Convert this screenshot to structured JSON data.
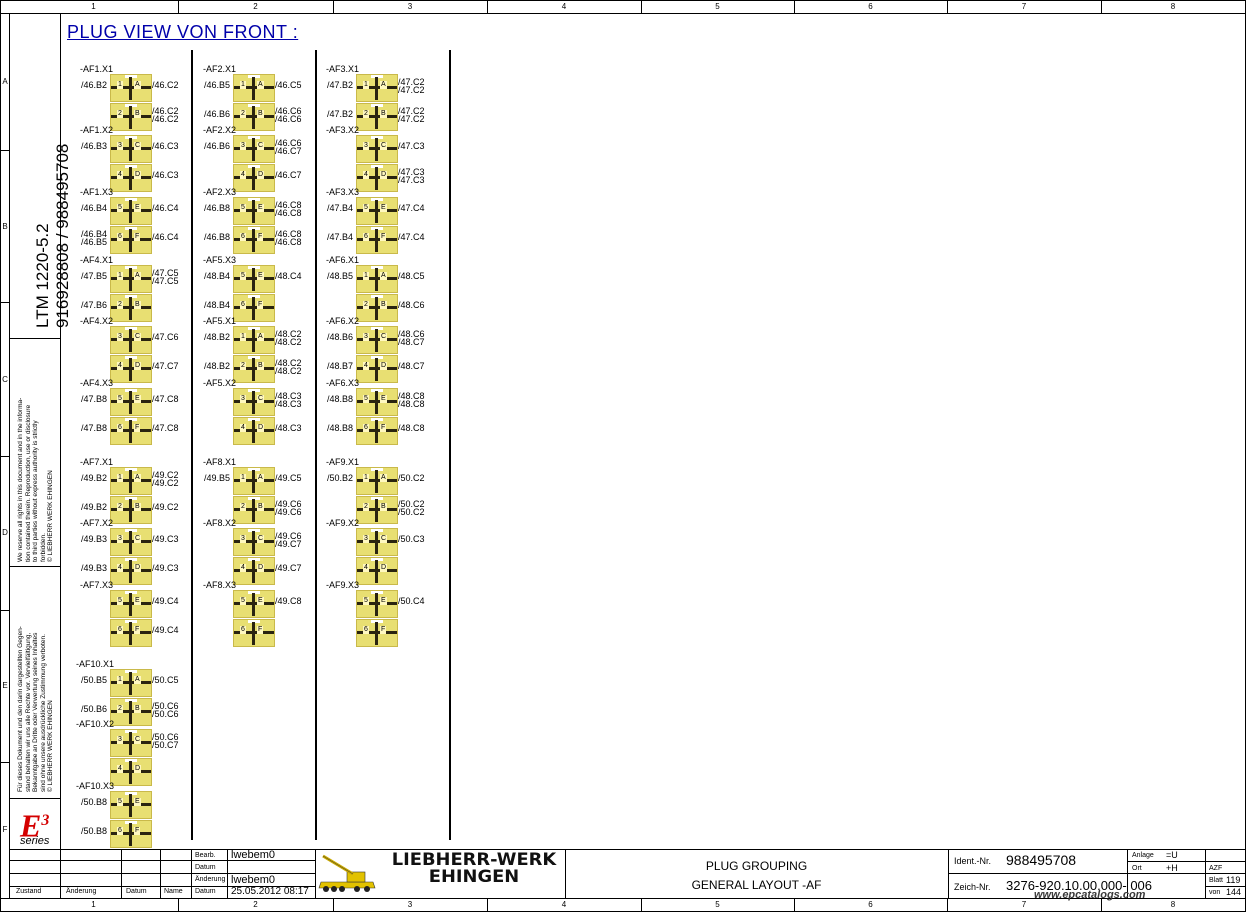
{
  "title": "PLUG VIEW VON FRONT :",
  "grid": {
    "columns": [
      "1",
      "2",
      "3",
      "4",
      "5",
      "6",
      "7",
      "8"
    ],
    "rows": [
      "A",
      "B",
      "C",
      "D",
      "E",
      "F"
    ]
  },
  "side": {
    "model": "LTM 1220-5.2",
    "numbers": "916928808  /  988495708",
    "notice_en": [
      "We reserve all rights in this document and in the informa-",
      "tion contained therein. Reproduction, use or disclosure",
      "to third parties without express authority is strictly",
      "forbidden.",
      "© LIEBHERR WERK EHINGEN"
    ],
    "notice_de": [
      "Für dieses Dokument und den darin dargestellten Gegen-",
      "stand behalten wir uns alle Rechte vor. Vervielfältigung,",
      "Bekanntgabe an Dritte oder Verwertung seines Inhaltes",
      "sind ohne unsere ausdrückliche Zustimmung verboten.",
      "© LIEBHERR WERK EHINGEN"
    ],
    "brand": "E",
    "brand_sup": "3",
    "brand_sub": "series"
  },
  "plugs": [
    {
      "name": "-AF1.X1",
      "col": 0,
      "row": 0,
      "pins": [
        {
          "n": "1",
          "l": "A",
          "left": [
            "/46.B2"
          ],
          "right": [
            "/46.C2"
          ]
        },
        {
          "n": "2",
          "l": "B",
          "left": [],
          "right": [
            "/46.C2",
            "/46.C2"
          ]
        }
      ]
    },
    {
      "name": "-AF1.X2",
      "col": 0,
      "row": 1,
      "pins": [
        {
          "n": "3",
          "l": "C",
          "left": [
            "/46.B3"
          ],
          "right": [
            "/46.C3"
          ]
        },
        {
          "n": "4",
          "l": "D",
          "left": [],
          "right": [
            "/46.C3"
          ]
        }
      ]
    },
    {
      "name": "-AF1.X3",
      "col": 0,
      "row": 2,
      "pins": [
        {
          "n": "5",
          "l": "E",
          "left": [
            "/46.B4"
          ],
          "right": [
            "/46.C4"
          ]
        },
        {
          "n": "6",
          "l": "F",
          "left": [
            "/46.B4",
            "/46.B5"
          ],
          "right": [
            "/46.C4"
          ]
        }
      ]
    },
    {
      "name": "-AF4.X1",
      "col": 0,
      "row": 3,
      "pins": [
        {
          "n": "1",
          "l": "A",
          "left": [
            "/47.B5"
          ],
          "right": [
            "/47.C5",
            "/47.C5"
          ]
        },
        {
          "n": "2",
          "l": "B",
          "left": [
            "/47.B6"
          ],
          "right": []
        }
      ]
    },
    {
      "name": "-AF4.X2",
      "col": 0,
      "row": 4,
      "pins": [
        {
          "n": "3",
          "l": "C",
          "left": [],
          "right": [
            "/47.C6"
          ]
        },
        {
          "n": "4",
          "l": "D",
          "left": [],
          "right": [
            "/47.C7"
          ]
        }
      ]
    },
    {
      "name": "-AF4.X3",
      "col": 0,
      "row": 5,
      "pins": [
        {
          "n": "5",
          "l": "E",
          "left": [
            "/47.B8"
          ],
          "right": [
            "/47.C8"
          ]
        },
        {
          "n": "6",
          "l": "F",
          "left": [
            "/47.B8"
          ],
          "right": [
            "/47.C8"
          ]
        }
      ]
    },
    {
      "name": "-AF7.X1",
      "col": 0,
      "row": 6,
      "pins": [
        {
          "n": "1",
          "l": "A",
          "left": [
            "/49.B2"
          ],
          "right": [
            "/49.C2",
            "/49.C2"
          ]
        },
        {
          "n": "2",
          "l": "B",
          "left": [
            "/49.B2"
          ],
          "right": [
            "/49.C2"
          ]
        }
      ]
    },
    {
      "name": "-AF7.X2",
      "col": 0,
      "row": 7,
      "pins": [
        {
          "n": "3",
          "l": "C",
          "left": [
            "/49.B3"
          ],
          "right": [
            "/49.C3"
          ]
        },
        {
          "n": "4",
          "l": "D",
          "left": [
            "/49.B3"
          ],
          "right": [
            "/49.C3"
          ]
        }
      ]
    },
    {
      "name": "-AF7.X3",
      "col": 0,
      "row": 8,
      "pins": [
        {
          "n": "5",
          "l": "E",
          "left": [],
          "right": [
            "/49.C4"
          ]
        },
        {
          "n": "6",
          "l": "F",
          "left": [],
          "right": [
            "/49.C4"
          ]
        }
      ]
    },
    {
      "name": "-AF10.X1",
      "col": 0,
      "row": 9,
      "pins": [
        {
          "n": "1",
          "l": "A",
          "left": [
            "/50.B5"
          ],
          "right": [
            "/50.C5"
          ]
        },
        {
          "n": "2",
          "l": "B",
          "left": [
            "/50.B6"
          ],
          "right": [
            "/50.C6",
            "/50.C6"
          ]
        }
      ]
    },
    {
      "name": "-AF10.X2",
      "col": 0,
      "row": 10,
      "pins": [
        {
          "n": "3",
          "l": "C",
          "left": [],
          "right": [
            "/50.C6",
            "/50.C7"
          ]
        },
        {
          "n": "4",
          "l": "D",
          "left": [],
          "right": []
        }
      ]
    },
    {
      "name": "-AF10.X3",
      "col": 0,
      "row": 11,
      "pins": [
        {
          "n": "5",
          "l": "E",
          "left": [
            "/50.B8"
          ],
          "right": []
        },
        {
          "n": "6",
          "l": "F",
          "left": [
            "/50.B8"
          ],
          "right": []
        }
      ]
    },
    {
      "name": "-AF2.X1",
      "col": 1,
      "row": 0,
      "pins": [
        {
          "n": "1",
          "l": "A",
          "left": [
            "/46.B5"
          ],
          "right": [
            "/46.C5"
          ]
        },
        {
          "n": "2",
          "l": "B",
          "left": [
            "/46.B6"
          ],
          "right": [
            "/46.C6",
            "/46.C6"
          ]
        }
      ]
    },
    {
      "name": "-AF2.X2",
      "col": 1,
      "row": 1,
      "pins": [
        {
          "n": "3",
          "l": "C",
          "left": [
            "/46.B6"
          ],
          "right": [
            "/46.C6",
            "/46.C7"
          ]
        },
        {
          "n": "4",
          "l": "D",
          "left": [],
          "right": [
            "/46.C7"
          ]
        }
      ]
    },
    {
      "name": "-AF2.X3",
      "col": 1,
      "row": 2,
      "pins": [
        {
          "n": "5",
          "l": "E",
          "left": [
            "/46.B8"
          ],
          "right": [
            "/46.C8",
            "/46.C8"
          ]
        },
        {
          "n": "6",
          "l": "F",
          "left": [
            "/46.B8"
          ],
          "right": [
            "/46.C8",
            "/46.C8"
          ]
        }
      ]
    },
    {
      "name": "-AF5.X3",
      "col": 1,
      "row": 3,
      "pins": [
        {
          "n": "5",
          "l": "E",
          "left": [
            "/48.B4"
          ],
          "right": [
            "/48.C4"
          ]
        },
        {
          "n": "6",
          "l": "F",
          "left": [
            "/48.B4"
          ],
          "right": []
        }
      ]
    },
    {
      "name": "-AF5.X1",
      "col": 1,
      "row": 4,
      "pins": [
        {
          "n": "1",
          "l": "A",
          "left": [
            "/48.B2"
          ],
          "right": [
            "/48.C2",
            "/48.C2"
          ]
        },
        {
          "n": "2",
          "l": "B",
          "left": [
            "/48.B2"
          ],
          "right": [
            "/48.C2",
            "/48.C2"
          ]
        }
      ]
    },
    {
      "name": "-AF5.X2",
      "col": 1,
      "row": 5,
      "pins": [
        {
          "n": "3",
          "l": "C",
          "left": [],
          "right": [
            "/48.C3",
            "/48.C3"
          ]
        },
        {
          "n": "4",
          "l": "D",
          "left": [],
          "right": [
            "/48.C3"
          ]
        }
      ]
    },
    {
      "name": "-AF8.X1",
      "col": 1,
      "row": 6,
      "pins": [
        {
          "n": "1",
          "l": "A",
          "left": [
            "/49.B5"
          ],
          "right": [
            "/49.C5"
          ]
        },
        {
          "n": "2",
          "l": "B",
          "left": [],
          "right": [
            "/49.C6",
            "/49.C6"
          ]
        }
      ]
    },
    {
      "name": "-AF8.X2",
      "col": 1,
      "row": 7,
      "pins": [
        {
          "n": "3",
          "l": "C",
          "left": [],
          "right": [
            "/49.C6",
            "/49.C7"
          ]
        },
        {
          "n": "4",
          "l": "D",
          "left": [],
          "right": [
            "/49.C7"
          ]
        }
      ]
    },
    {
      "name": "-AF8.X3",
      "col": 1,
      "row": 8,
      "pins": [
        {
          "n": "5",
          "l": "E",
          "left": [],
          "right": [
            "/49.C8"
          ]
        },
        {
          "n": "6",
          "l": "F",
          "left": [],
          "right": []
        }
      ]
    },
    {
      "name": "-AF3.X1",
      "col": 2,
      "row": 0,
      "pins": [
        {
          "n": "1",
          "l": "A",
          "left": [
            "/47.B2"
          ],
          "right": [
            "/47.C2",
            "/47.C2"
          ]
        },
        {
          "n": "2",
          "l": "B",
          "left": [
            "/47.B2"
          ],
          "right": [
            "/47.C2",
            "/47.C2"
          ]
        }
      ]
    },
    {
      "name": "-AF3.X2",
      "col": 2,
      "row": 1,
      "pins": [
        {
          "n": "3",
          "l": "C",
          "left": [],
          "right": [
            "/47.C3"
          ]
        },
        {
          "n": "4",
          "l": "D",
          "left": [],
          "right": [
            "/47.C3",
            "/47.C3"
          ]
        }
      ]
    },
    {
      "name": "-AF3.X3",
      "col": 2,
      "row": 2,
      "pins": [
        {
          "n": "5",
          "l": "E",
          "left": [
            "/47.B4"
          ],
          "right": [
            "/47.C4"
          ]
        },
        {
          "n": "6",
          "l": "F",
          "left": [
            "/47.B4"
          ],
          "right": [
            "/47.C4"
          ]
        }
      ]
    },
    {
      "name": "-AF6.X1",
      "col": 2,
      "row": 3,
      "pins": [
        {
          "n": "1",
          "l": "A",
          "left": [
            "/48.B5"
          ],
          "right": [
            "/48.C5"
          ]
        },
        {
          "n": "2",
          "l": "B",
          "left": [],
          "right": [
            "/48.C6"
          ]
        }
      ]
    },
    {
      "name": "-AF6.X2",
      "col": 2,
      "row": 4,
      "pins": [
        {
          "n": "3",
          "l": "C",
          "left": [
            "/48.B6"
          ],
          "right": [
            "/48.C6",
            "/48.C7"
          ]
        },
        {
          "n": "4",
          "l": "D",
          "left": [
            "/48.B7"
          ],
          "right": [
            "/48.C7"
          ]
        }
      ]
    },
    {
      "name": "-AF6.X3",
      "col": 2,
      "row": 5,
      "pins": [
        {
          "n": "5",
          "l": "E",
          "left": [
            "/48.B8"
          ],
          "right": [
            "/48.C8",
            "/48.C8"
          ]
        },
        {
          "n": "6",
          "l": "F",
          "left": [
            "/48.B8"
          ],
          "right": [
            "/48.C8"
          ]
        }
      ]
    },
    {
      "name": "-AF9.X1",
      "col": 2,
      "row": 6,
      "pins": [
        {
          "n": "1",
          "l": "A",
          "left": [
            "/50.B2"
          ],
          "right": [
            "/50.C2"
          ]
        },
        {
          "n": "2",
          "l": "B",
          "left": [],
          "right": [
            "/50.C2",
            "/50.C2"
          ]
        }
      ]
    },
    {
      "name": "-AF9.X2",
      "col": 2,
      "row": 7,
      "pins": [
        {
          "n": "3",
          "l": "C",
          "left": [],
          "right": [
            "/50.C3"
          ]
        },
        {
          "n": "4",
          "l": "D",
          "left": [],
          "right": []
        }
      ]
    },
    {
      "name": "-AF9.X3",
      "col": 2,
      "row": 8,
      "pins": [
        {
          "n": "5",
          "l": "E",
          "left": [],
          "right": [
            "/50.C4"
          ]
        },
        {
          "n": "6",
          "l": "F",
          "left": [],
          "right": []
        }
      ]
    }
  ],
  "titleblock": {
    "labels": {
      "zustand": "Zustand",
      "aenderung": "Änderung",
      "datum": "Datum",
      "name": "Name",
      "bearb": "Bearb.",
      "datum2": "Datum",
      "aenderung2": "Änderung",
      "datum3": "Datum"
    },
    "bearb_value": "lwebem0",
    "aenderung_value": "lwebem0",
    "date_value": "25.05.2012  08:17",
    "company": [
      "LIEBHERR-WERK",
      "EHINGEN"
    ],
    "desc1": "PLUG GROUPING",
    "desc2": "GENERAL LAYOUT -AF",
    "ident_label": "Ident.-Nr.",
    "ident_value": "988495708",
    "zeich_label": "Zeich-Nr.",
    "zeich_value": "3276-920.10.00.000- 006",
    "anlage_label": "Anlage",
    "anlage_value": "=U",
    "ort_label": "Ort",
    "ort_value": "+H",
    "azf": "AZF",
    "blatt_label": "Blatt",
    "blatt_value": "119",
    "von_label": "von",
    "von_value": "144"
  },
  "watermark": "www.epcatalogs.com"
}
